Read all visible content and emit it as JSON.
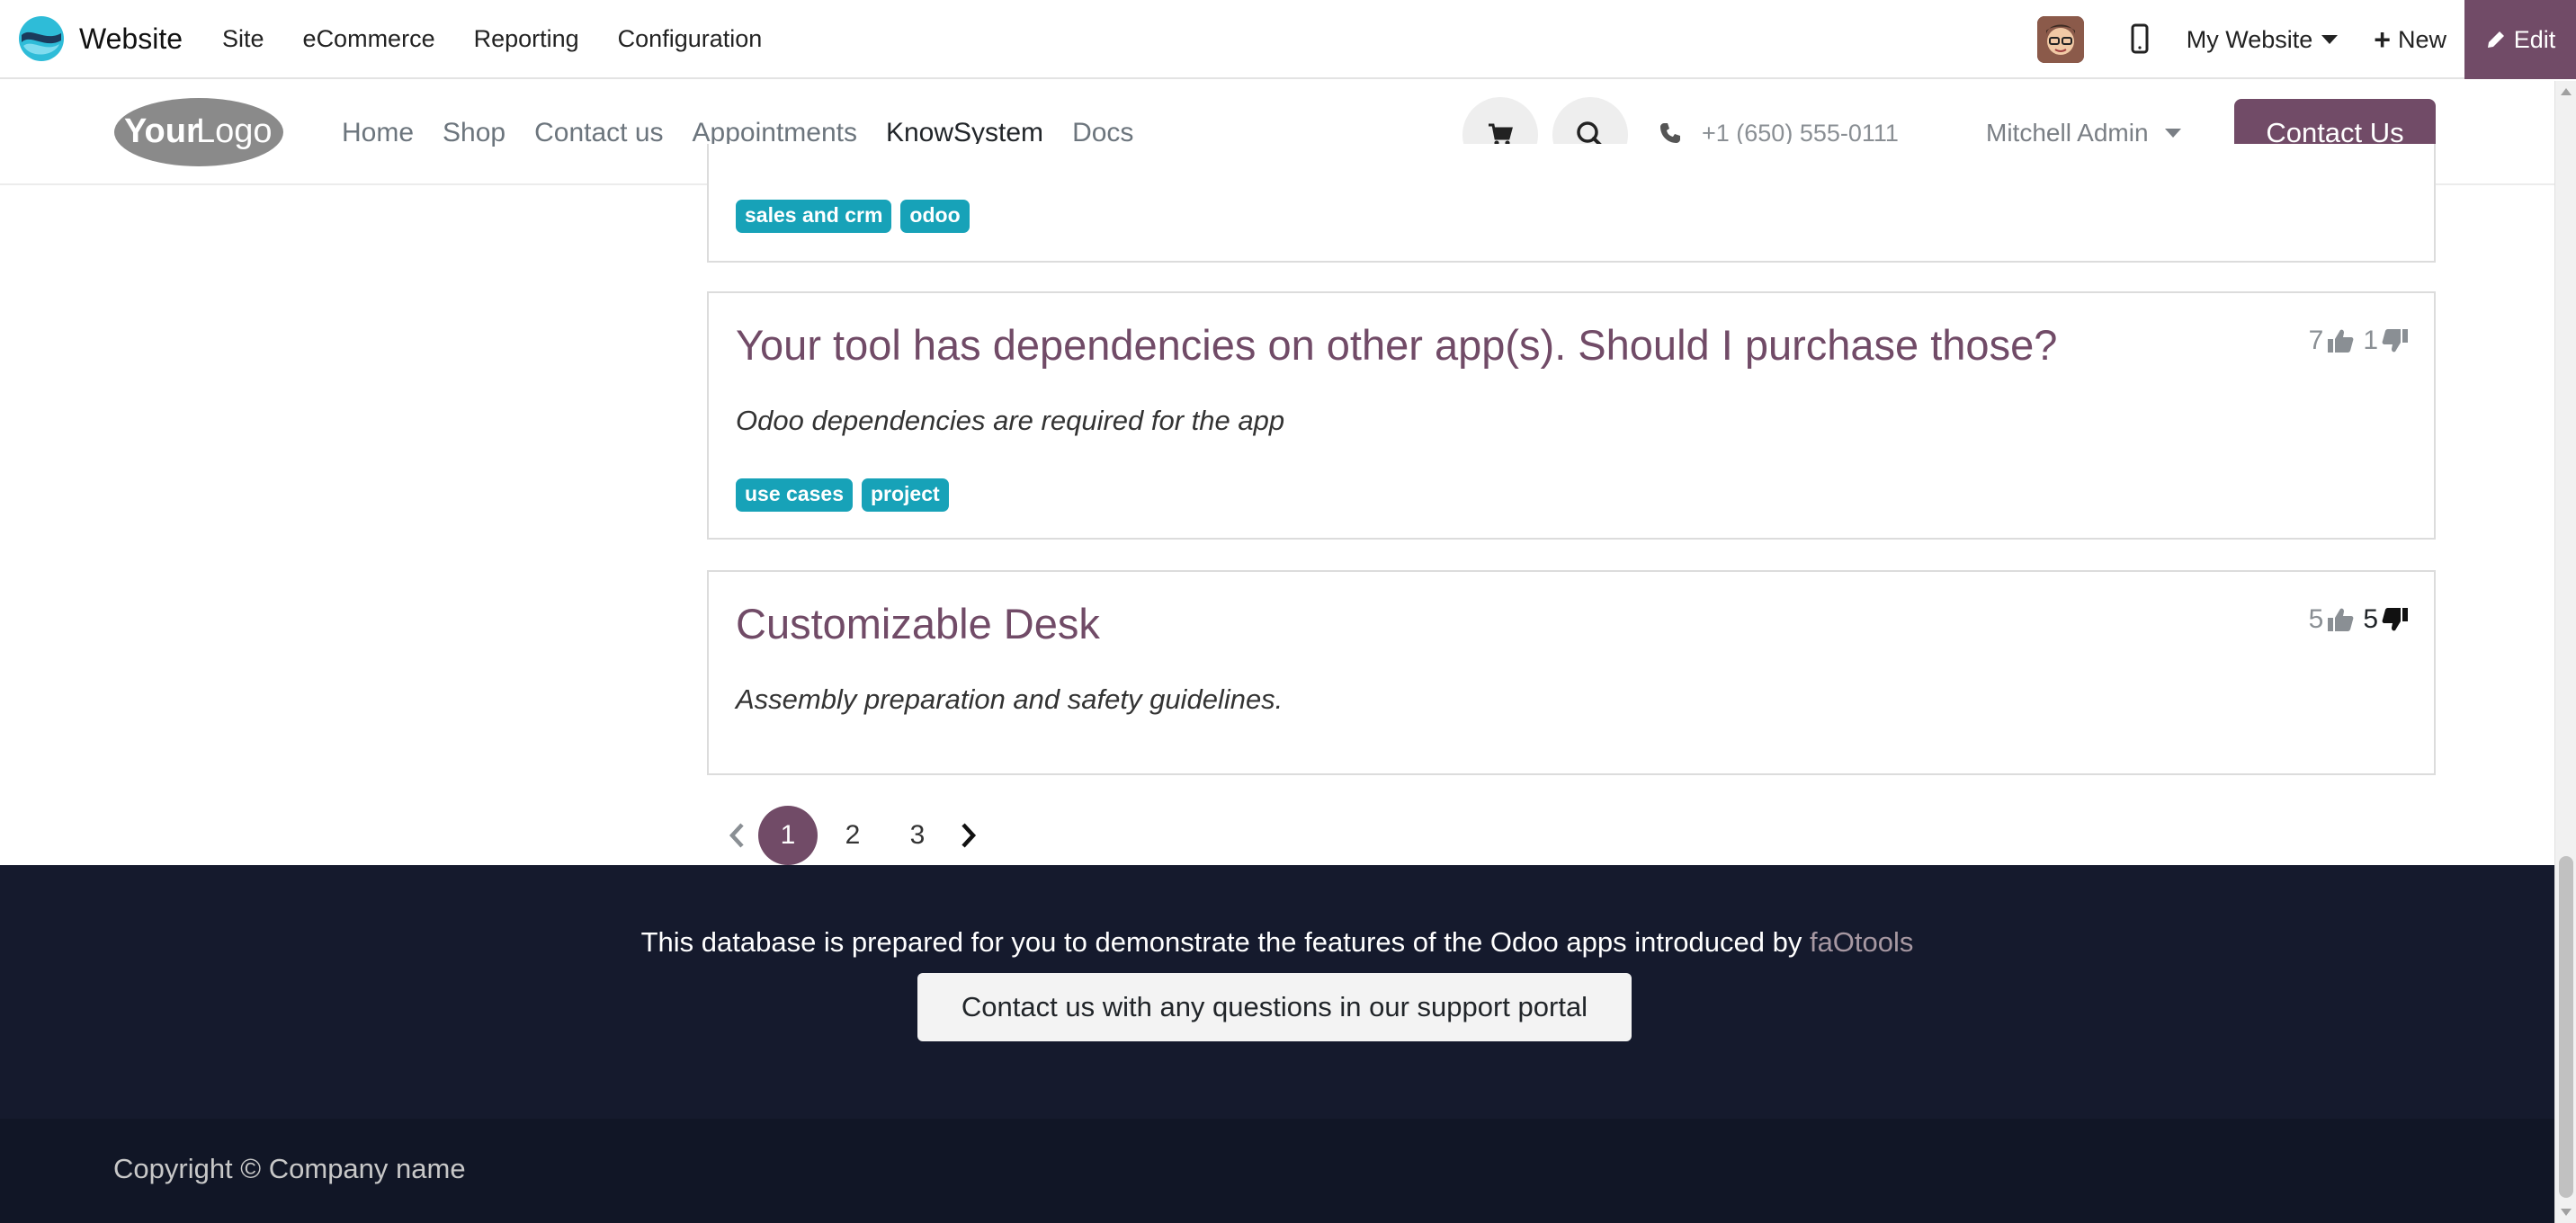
{
  "adminbar": {
    "app_name": "Website",
    "menu": [
      "Site",
      "eCommerce",
      "Reporting",
      "Configuration"
    ],
    "website_selector": "My Website",
    "new_label": "New",
    "edit_label": "Edit",
    "accent": "#714b67"
  },
  "header": {
    "logo_text_bold": "Your",
    "logo_text_light": "Logo",
    "menu": [
      "Home",
      "Shop",
      "Contact us",
      "Appointments",
      "KnowSystem",
      "Docs"
    ],
    "active_menu": "KnowSystem",
    "phone": "+1 (650) 555-0111",
    "user": "Mitchell Admin",
    "contact_button": "Contact Us"
  },
  "articles": [
    {
      "title": "",
      "description": "",
      "tags": [
        "sales and crm",
        "odoo"
      ]
    },
    {
      "title": "Your tool has dependencies on other app(s). Should I purchase those?",
      "description": "Odoo dependencies are required for the app",
      "tags": [
        "use cases",
        "project"
      ],
      "likes": "7",
      "dislikes": "1"
    },
    {
      "title": "Customizable Desk",
      "description": "Assembly preparation and safety guidelines.",
      "tags": [],
      "likes": "5",
      "dislikes": "5"
    }
  ],
  "pagination": {
    "pages": [
      "1",
      "2",
      "3"
    ],
    "current": "1"
  },
  "footer": {
    "text": "This database is prepared for you to demonstrate the features of the Odoo apps introduced by",
    "link": "faOtools",
    "support_button": "Contact us with any questions in our support portal",
    "copyright": "Copyright © Company name"
  }
}
